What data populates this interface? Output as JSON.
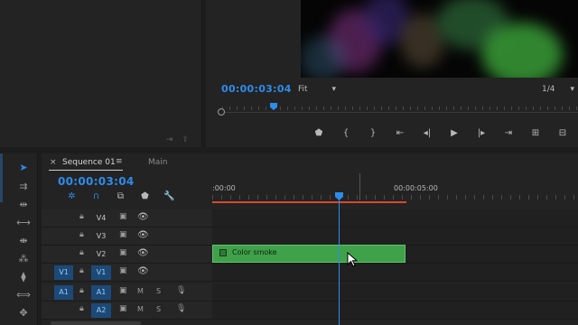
{
  "program": {
    "timecode": "00:00:03:04",
    "fit": "Fit",
    "fraction": "1/4",
    "transport": [
      "marker-icon",
      "mark-in-icon",
      "mark-out-icon",
      "go-to-in-icon",
      "step-back-icon",
      "play-icon",
      "step-forward-icon",
      "go-to-out-icon",
      "insert-icon",
      "overwrite-icon",
      "export-frame-icon"
    ]
  },
  "timeline": {
    "tab_close": "×",
    "tab_sequence": "Sequence 01",
    "tab_menu": "≡",
    "tab_main": "Main",
    "timecode": "00:00:03:04",
    "ruler_start": ":00:00",
    "ruler_end": "00:00:05:00",
    "tracks": [
      {
        "label": "V4",
        "type": "video"
      },
      {
        "label": "V3",
        "type": "video"
      },
      {
        "label": "V2",
        "type": "video"
      },
      {
        "label": "V1",
        "type": "video",
        "target": "V1"
      },
      {
        "label": "A1",
        "type": "audio",
        "target": "A1",
        "mute": "M",
        "solo": "S"
      },
      {
        "label": "A2",
        "type": "audio",
        "mute": "M",
        "solo": "S"
      }
    ],
    "clip_name": "Color smoke"
  },
  "colors": {
    "accent": "#2d8ceb",
    "clip": "#3fa14a",
    "work_area": "#d9492c"
  }
}
